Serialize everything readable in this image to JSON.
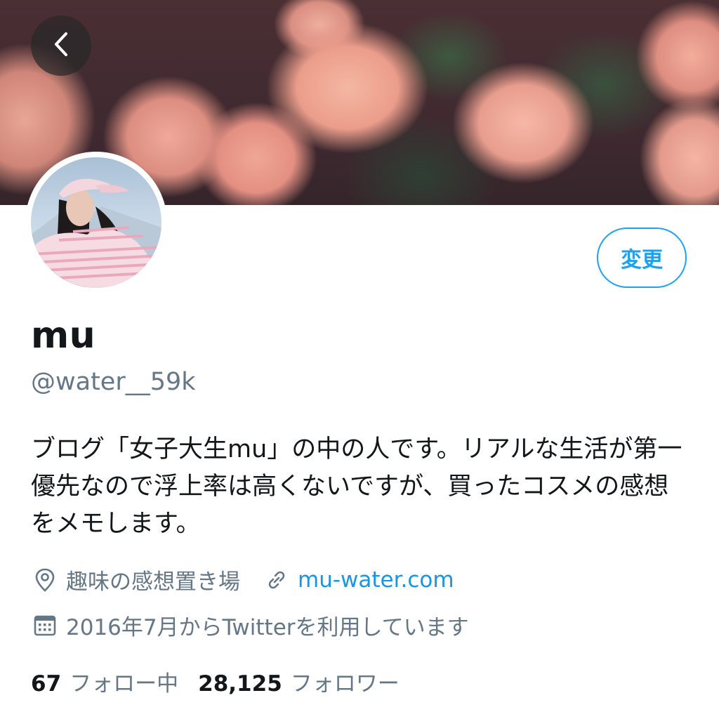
{
  "header": {
    "back_icon": "chevron-left-icon"
  },
  "profile": {
    "name": "mu",
    "handle": "@water__59k",
    "edit_label": "変更",
    "bio": "ブログ「女子大生mu」の中の人です。リアルな生活が第一優先なので浮上率は高くないですが、買ったコスメの感想をメモします。",
    "location": "趣味の感想置き場",
    "location_icon": "location-pin-icon",
    "website": "mu-water.com",
    "website_icon": "link-icon",
    "joined": "2016年7月からTwitterを利用しています",
    "joined_icon": "calendar-icon"
  },
  "stats": {
    "following_count": "67",
    "following_label": "フォロー中",
    "followers_count": "28,125",
    "followers_label": "フォロワー"
  },
  "colors": {
    "accent": "#1da1f2",
    "secondary_text": "#657786",
    "primary_text": "#14171a"
  }
}
